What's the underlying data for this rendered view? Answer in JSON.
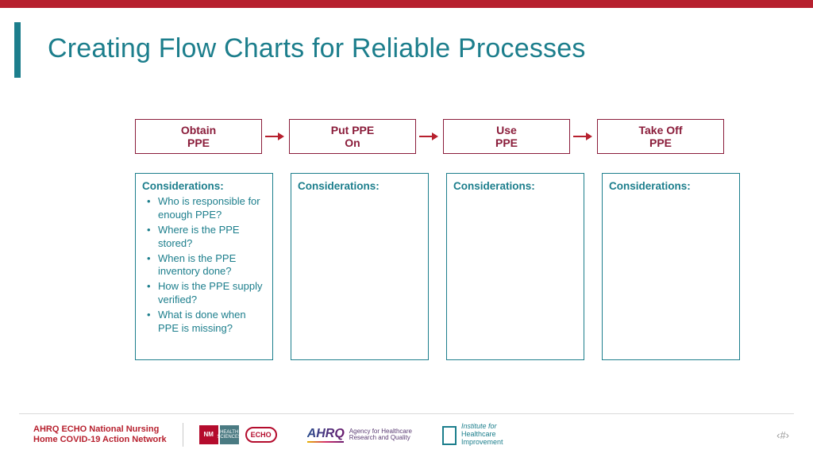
{
  "title": "Creating Flow Charts for Reliable Processes",
  "steps": [
    {
      "line1": "Obtain",
      "line2": "PPE"
    },
    {
      "line1": "Put PPE",
      "line2": "On"
    },
    {
      "line1": "Use",
      "line2": "PPE"
    },
    {
      "line1": "Take Off",
      "line2": "PPE"
    }
  ],
  "boxes": [
    {
      "title": "Considerations:",
      "items": [
        "Who is responsible for enough PPE?",
        "Where is the PPE stored?",
        "When is the PPE inventory done?",
        "How is the PPE supply verified?",
        "What is done when PPE is missing?"
      ]
    },
    {
      "title": "Considerations:",
      "items": []
    },
    {
      "title": "Considerations:",
      "items": []
    },
    {
      "title": "Considerations:",
      "items": []
    }
  ],
  "footer": {
    "program_line1": "AHRQ ECHO National Nursing",
    "program_line2": "Home COVID-19 Action Network",
    "unm_abbr": "NM",
    "unm_health": "HEALTH",
    "unm_sci": "SCIENCES",
    "echo": "ECHO",
    "ahrq": "AHRQ",
    "ahrq_sub1": "Agency for Healthcare",
    "ahrq_sub2": "Research and Quality",
    "ihi_l1": "Institute for",
    "ihi_l2": "Healthcare",
    "ihi_l3": "Improvement",
    "pagenum": "‹#›"
  }
}
